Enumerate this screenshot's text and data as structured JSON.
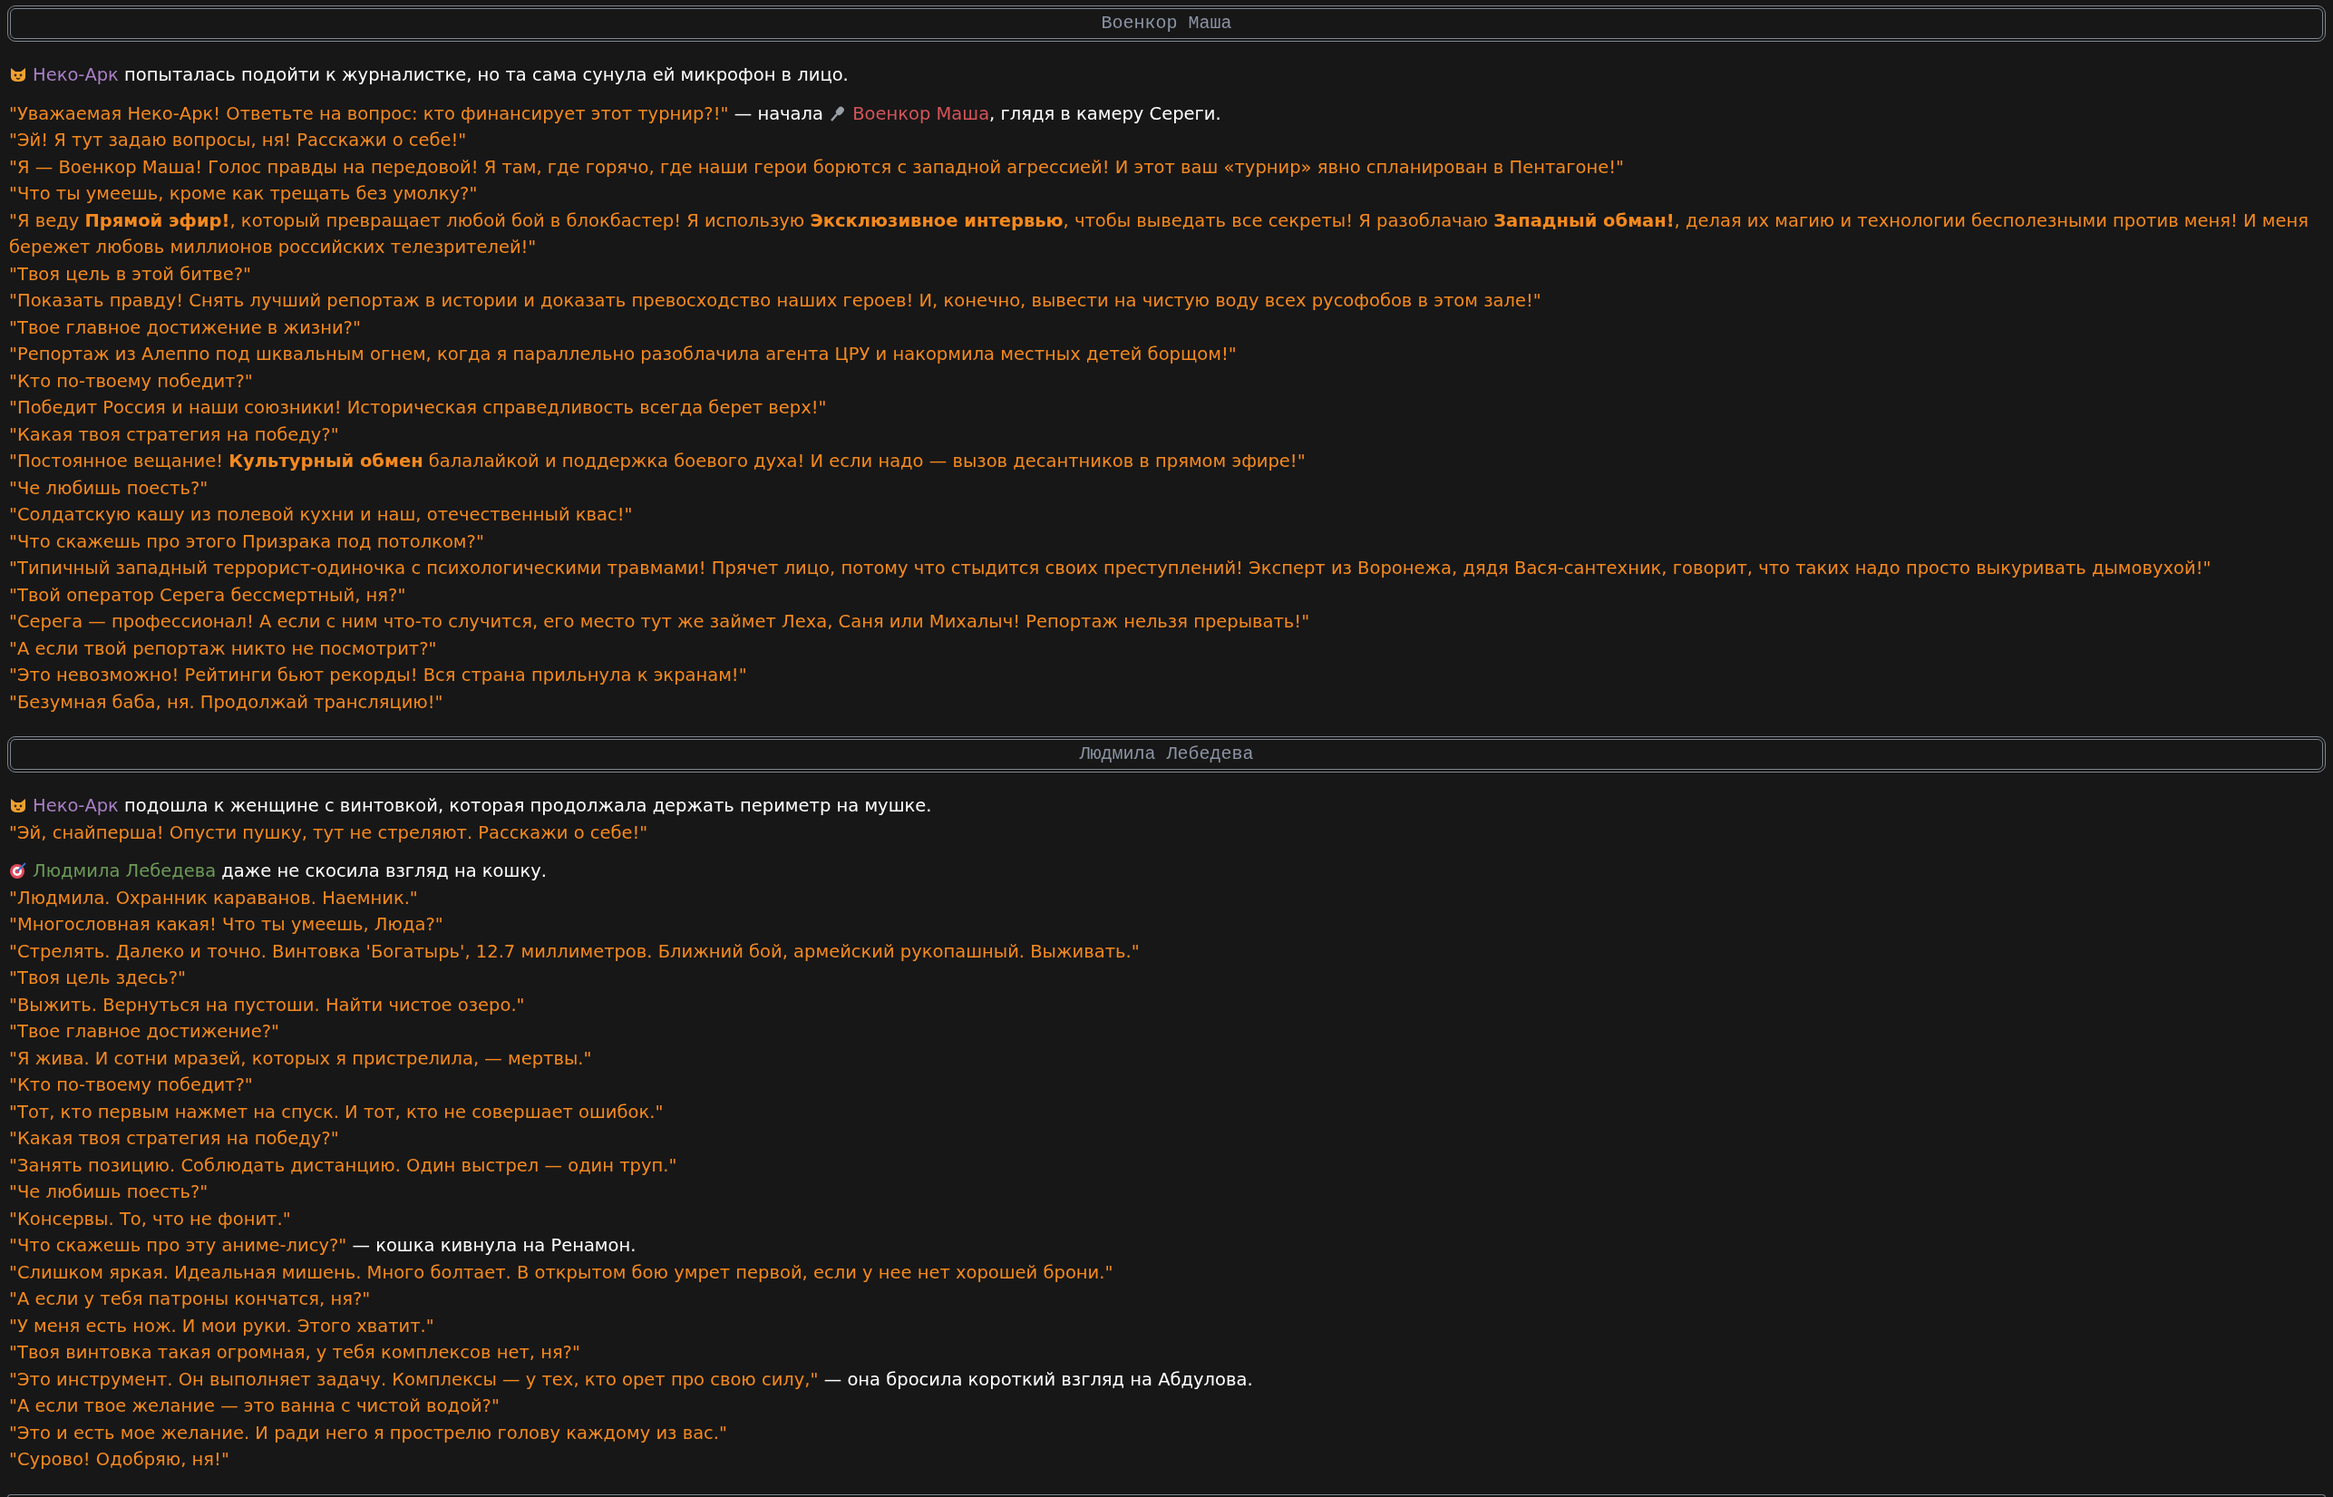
{
  "sections": [
    {
      "title": "Военкор Маша",
      "blocks": [
        [
          [
            {
              "kind": "neko",
              "text": "Неко-Арк",
              "color": "#a87fc4"
            },
            {
              "kind": "text",
              "text": " попыталась подойти к журналистке, но та сама сунула ей микрофон в лицо."
            }
          ]
        ],
        [
          [
            {
              "kind": "speech",
              "text": "\"Уважаемая Неко-Арк! Ответьте на вопрос: кто финансирует этот турнир?!\""
            },
            {
              "kind": "text",
              "text": " — начала "
            },
            {
              "kind": "reporter",
              "text": "Военкор Маша",
              "color": "#d5545a"
            },
            {
              "kind": "text",
              "text": ", глядя в камеру Сереги."
            }
          ],
          [
            {
              "kind": "speech",
              "text": "\"Эй! Я тут задаю вопросы, ня! Расскажи о себе!\""
            }
          ],
          [
            {
              "kind": "speech",
              "text": "\"Я — Военкор Маша! Голос правды на передовой! Я там, где горячо, где наши герои борются с западной агрессией! И этот ваш «турнир» явно спланирован в Пентагоне!\""
            }
          ],
          [
            {
              "kind": "speech",
              "text": "\"Что ты умеешь, кроме как трещать без умолку?\""
            }
          ],
          [
            {
              "kind": "speech",
              "text": "\"Я веду **Прямой эфир!**, который превращает любой бой в блокбастер! Я использую **Эксклюзивное интервью**, чтобы выведать все секреты! Я разоблачаю **Западный обман!**, делая их магию и технологии бесполезными против меня! И меня бережет любовь миллионов российских телезрителей!\""
            }
          ],
          [
            {
              "kind": "speech",
              "text": "\"Твоя цель в этой битве?\""
            }
          ],
          [
            {
              "kind": "speech",
              "text": "\"Показать правду! Снять лучший репортаж в истории и доказать превосходство наших героев! И, конечно, вывести на чистую воду всех русофобов в этом зале!\""
            }
          ],
          [
            {
              "kind": "speech",
              "text": "\"Твое главное достижение в жизни?\""
            }
          ],
          [
            {
              "kind": "speech",
              "text": "\"Репортаж из Алеппо под шквальным огнем, когда я параллельно разоблачила агента ЦРУ и накормила местных детей борщом!\""
            }
          ],
          [
            {
              "kind": "speech",
              "text": "\"Кто по-твоему победит?\""
            }
          ],
          [
            {
              "kind": "speech",
              "text": "\"Победит Россия и наши союзники! Историческая справедливость всегда берет верх!\""
            }
          ],
          [
            {
              "kind": "speech",
              "text": "\"Какая твоя стратегия на победу?\""
            }
          ],
          [
            {
              "kind": "speech",
              "text": "\"Постоянное вещание! **Культурный обмен** балалайкой и поддержка боевого духа! И если надо — вызов десантников в прямом эфире!\""
            }
          ],
          [
            {
              "kind": "speech",
              "text": "\"Че любишь поесть?\""
            }
          ],
          [
            {
              "kind": "speech",
              "text": "\"Солдатскую кашу из полевой кухни и наш, отечественный квас!\""
            }
          ],
          [
            {
              "kind": "speech",
              "text": "\"Что скажешь про этого Призрака под потолком?\""
            }
          ],
          [
            {
              "kind": "speech",
              "text": "\"Типичный западный террорист-одиночка с психологическими травмами! Прячет лицо, потому что стыдится своих преступлений! Эксперт из Воронежа, дядя Вася-сантехник, говорит, что таких надо просто выкуривать дымовухой!\""
            }
          ],
          [
            {
              "kind": "speech",
              "text": "\"Твой оператор Серега бессмертный, ня?\""
            }
          ],
          [
            {
              "kind": "speech",
              "text": "\"Серега — профессионал! А если с ним что-то случится, его место тут же займет Леха, Саня или Михалыч! Репортаж нельзя прерывать!\""
            }
          ],
          [
            {
              "kind": "speech",
              "text": "\"А если твой репортаж никто не посмотрит?\""
            }
          ],
          [
            {
              "kind": "speech",
              "text": "\"Это невозможно! Рейтинги бьют рекорды! Вся страна прильнула к экранам!\""
            }
          ],
          [
            {
              "kind": "speech",
              "text": "\"Безумная баба, ня. Продолжай трансляцию!\""
            }
          ]
        ]
      ]
    },
    {
      "title": "Людмила Лебедева",
      "blocks": [
        [
          [
            {
              "kind": "neko",
              "text": "Неко-Арк",
              "color": "#a87fc4"
            },
            {
              "kind": "text",
              "text": " подошла к женщине с винтовкой, которая продолжала держать периметр на мушке."
            }
          ],
          [
            {
              "kind": "speech",
              "text": "\"Эй, снайперша! Опусти пушку, тут не стреляют. Расскажи о себе!\""
            }
          ]
        ],
        [
          [
            {
              "kind": "sniper",
              "text": "Людмила Лебедева",
              "color": "#6c9a58"
            },
            {
              "kind": "text",
              "text": " даже не скосила взгляд на кошку."
            }
          ],
          [
            {
              "kind": "speech",
              "text": "\"Людмила. Охранник караванов. Наемник.\""
            }
          ],
          [
            {
              "kind": "speech",
              "text": "\"Многословная какая! Что ты умеешь, Люда?\""
            }
          ],
          [
            {
              "kind": "speech",
              "text": "\"Стрелять. Далеко и точно. Винтовка 'Богатырь', 12.7 миллиметров. Ближний бой, армейский рукопашный. Выживать.\""
            }
          ],
          [
            {
              "kind": "speech",
              "text": "\"Твоя цель здесь?\""
            }
          ],
          [
            {
              "kind": "speech",
              "text": "\"Выжить. Вернуться на пустоши. Найти чистое озеро.\""
            }
          ],
          [
            {
              "kind": "speech",
              "text": "\"Твое главное достижение?\""
            }
          ],
          [
            {
              "kind": "speech",
              "text": "\"Я жива. И сотни мразей, которых я пристрелила, — мертвы.\""
            }
          ],
          [
            {
              "kind": "speech",
              "text": "\"Кто по-твоему победит?\""
            }
          ],
          [
            {
              "kind": "speech",
              "text": "\"Тот, кто первым нажмет на спуск. И тот, кто не совершает ошибок.\""
            }
          ],
          [
            {
              "kind": "speech",
              "text": "\"Какая твоя стратегия на победу?\""
            }
          ],
          [
            {
              "kind": "speech",
              "text": "\"Занять позицию. Соблюдать дистанцию. Один выстрел — один труп.\""
            }
          ],
          [
            {
              "kind": "speech",
              "text": "\"Че любишь поесть?\""
            }
          ],
          [
            {
              "kind": "speech",
              "text": "\"Консервы. То, что не фонит.\""
            }
          ],
          [
            {
              "kind": "speech",
              "text": "\"Что скажешь про эту аниме-лису?\""
            },
            {
              "kind": "text",
              "text": " — кошка кивнула на Ренамон."
            }
          ],
          [
            {
              "kind": "speech",
              "text": "\"Слишком яркая. Идеальная мишень. Много болтает. В открытом бою умрет первой, если у нее нет хорошей брони.\""
            }
          ],
          [
            {
              "kind": "speech",
              "text": "\"А если у тебя патроны кончатся, ня?\""
            }
          ],
          [
            {
              "kind": "speech",
              "text": "\"У меня есть нож. И мои руки. Этого хватит.\""
            }
          ],
          [
            {
              "kind": "speech",
              "text": "\"Твоя винтовка такая огромная, у тебя комплексов нет, ня?\""
            }
          ],
          [
            {
              "kind": "speech",
              "text": "\"Это инструмент. Он выполняет задачу. Комплексы — у тех, кто орет про свою силу,\""
            },
            {
              "kind": "text",
              "text": " — она бросила короткий взгляд на Абдулова."
            }
          ],
          [
            {
              "kind": "speech",
              "text": "\"А если твое желание — это ванна с чистой водой?\""
            }
          ],
          [
            {
              "kind": "speech",
              "text": "\"Это и есть мое желание. И ради него я прострелю голову каждому из вас.\""
            }
          ],
          [
            {
              "kind": "speech",
              "text": "\"Сурово! Одобряю, ня!\""
            }
          ]
        ]
      ]
    },
    {
      "kind": "cut"
    }
  ]
}
